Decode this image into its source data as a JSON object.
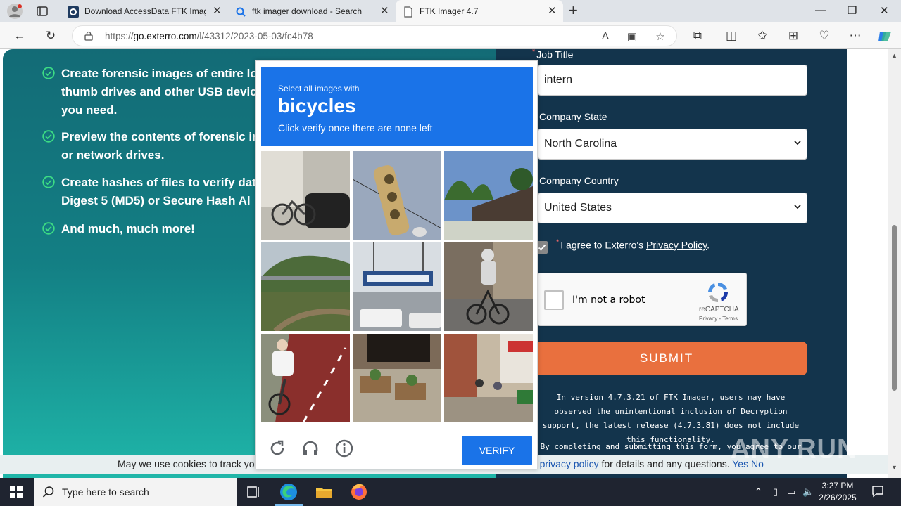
{
  "browser": {
    "tabs": [
      {
        "title": "Download AccessData FTK Imag",
        "active": false
      },
      {
        "title": "ftk imager download - Search",
        "active": false
      },
      {
        "title": "FTK Imager 4.7",
        "active": true
      }
    ],
    "url_prefix": "https://",
    "url_domain": "go.exterro.com",
    "url_path": "/l/43312/2023-05-03/fc4b78"
  },
  "features": [
    {
      "line1": "Create forensic images of entire lo",
      "line2": "thumb drives and other USB devic",
      "line3": "you need."
    },
    {
      "line1": "Preview the contents of forensic in",
      "line2": "or network drives."
    },
    {
      "line1": "Create hashes of files to verify dat",
      "line2": "Digest 5 (MD5) or Secure Hash Al"
    },
    {
      "line1": "And much, much more!"
    }
  ],
  "form": {
    "job_title_label": "Job Title",
    "job_title_value": "intern",
    "state_label": "Company State",
    "state_value": "North Carolina",
    "country_label": "Company Country",
    "country_value": "United States",
    "agree_text": "I agree to Exterro's",
    "agree_link": "Privacy Policy",
    "agree_end": ".",
    "recaptcha_label": "I'm not a robot",
    "recaptcha_brand": "reCAPTCHA",
    "recaptcha_terms": "Privacy - Terms",
    "submit_label": "SUBMIT",
    "note1": "In version 4.7.3.21 of FTK Imager, users may have observed the unintentional inclusion of Decryption support, the latest release (4.7.3.81) does not include this functionality.",
    "note2": "By completing and submitting this form, you agree to our privacy policy and consent to receive marketing emails."
  },
  "cookie": {
    "text_start": "May we use cookies to track yo",
    "text_mid": "r",
    "link": "privacy policy",
    "text_end": "for details and any questions.",
    "yes": "Yes",
    "no": "No"
  },
  "watermark": "ANY RUN",
  "captcha": {
    "instruction": "Select all images with",
    "target": "bicycles",
    "subtext": "Click verify once there are none left",
    "verify_label": "VERIFY",
    "tiles": [
      "bicycle near parked car",
      "traffic light",
      "rooftops and trees",
      "river bridge",
      "street sign and cars",
      "cyclist on street",
      "cyclist on red lane",
      "plants in planters",
      "sidewalk cafe"
    ]
  },
  "taskbar": {
    "search_placeholder": "Type here to search",
    "time": "3:27 PM",
    "date": "2/26/2025"
  },
  "colors": {
    "teal": "#137f84",
    "navy": "#13344c",
    "submit": "#e9703e",
    "captcha_blue": "#1a73e8"
  }
}
